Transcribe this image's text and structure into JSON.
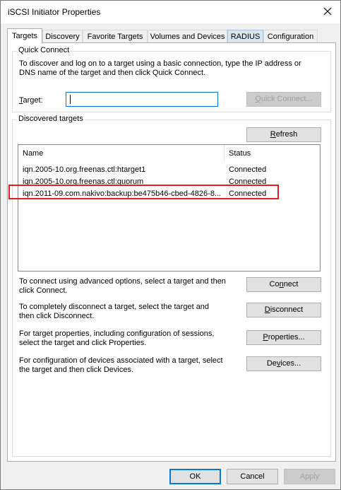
{
  "window": {
    "title": "iSCSI Initiator Properties"
  },
  "tabs": [
    {
      "label": "Targets"
    },
    {
      "label": "Discovery"
    },
    {
      "label": "Favorite Targets"
    },
    {
      "label": "Volumes and Devices"
    },
    {
      "label": "RADIUS"
    },
    {
      "label": "Configuration"
    }
  ],
  "quick_connect": {
    "group_label": "Quick Connect",
    "description_line1": "To discover and log on to a target using a basic connection, type the IP address or",
    "description_line2": "DNS name of the target and then click Quick Connect.",
    "target_label_prefix": "T",
    "target_label_rest": "arget:",
    "target_value": "",
    "quick_connect_u": "Q",
    "quick_connect_rest": "uick Connect..."
  },
  "discovered": {
    "group_label": "Discovered targets",
    "refresh_u": "R",
    "refresh_rest": "efresh",
    "columns": {
      "name": "Name",
      "status": "Status"
    },
    "rows": [
      {
        "name": "iqn.2005-10.org.freenas.ctl:htarget1",
        "status": "Connected"
      },
      {
        "name": "iqn.2005-10.org.freenas.ctl:quorum",
        "status": "Connected"
      },
      {
        "name": "iqn.2011-09.com.nakivo:backup:be475b46-cbed-4826-8...",
        "status": "Connected"
      }
    ]
  },
  "actions": {
    "connect_text1": "To connect using advanced options, select a target and then",
    "connect_text2": "click Connect.",
    "connect_pre": "Co",
    "connect_u": "n",
    "connect_post": "nect",
    "disconnect_text1": "To completely disconnect a target, select the target and",
    "disconnect_text2": "then click Disconnect.",
    "disconnect_u": "D",
    "disconnect_rest": "isconnect",
    "properties_text1": "For target properties, including configuration of sessions,",
    "properties_text2": "select the target and click Properties.",
    "properties_u": "P",
    "properties_rest": "roperties...",
    "devices_text1": "For configuration of devices associated with a target, select",
    "devices_text2": "the target and then click Devices.",
    "devices_pre": "De",
    "devices_u": "v",
    "devices_post": "ices..."
  },
  "footer": {
    "ok": "OK",
    "cancel": "Cancel",
    "apply": "Apply"
  },
  "colors": {
    "accent": "#0078d7",
    "highlight": "#e02020"
  }
}
